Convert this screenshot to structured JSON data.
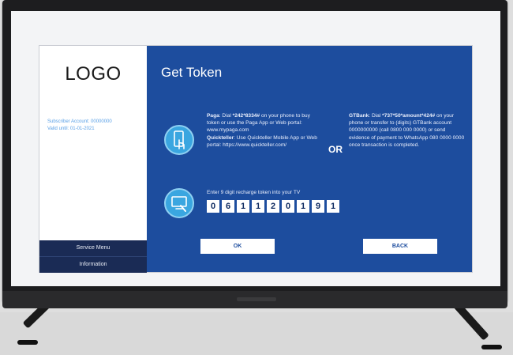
{
  "sidebar": {
    "logo": "LOGO",
    "info_lines": [
      "Subscriber Account: 00000000",
      "Valid until: 01-01-2021"
    ],
    "menu": [
      {
        "label": "Service Menu"
      },
      {
        "label": "Information"
      }
    ]
  },
  "main": {
    "title": "Get Token",
    "paga": {
      "name": "Paga",
      "text1": ": Dial ",
      "code": "*242*8334#",
      "text2": " on your phone to buy token or use the Paga App or Web portal: www.mypaga.com",
      "qt_name": "Quickteller",
      "qt_text": ": Use Quickteller Mobile App or Web portal: https://www.quickteller.com/"
    },
    "or_label": "OR",
    "gtbank": {
      "name": "GTBank",
      "text1": ": Dial ",
      "code": "*737*50*amount*424#",
      "text2": " on your phone or transfer to (digits) GTBank account 0000000000 (call 0800 000 0000) or send evidence of payment to WhatsApp 080 0000 0000 once transaction is completed."
    },
    "token_label": "Enter 9 digit recharge token into your TV",
    "token_digits": [
      "0",
      "6",
      "1",
      "1",
      "2",
      "0",
      "1",
      "9",
      "1"
    ],
    "buttons": {
      "ok": "OK",
      "back": "BACK"
    }
  },
  "colors": {
    "panel": "#1d4d9e",
    "icon": "#3aa6e0",
    "sidebar_menu": "#1a2b55"
  },
  "icons": [
    "phone-touch-icon",
    "tv-remote-icon"
  ]
}
